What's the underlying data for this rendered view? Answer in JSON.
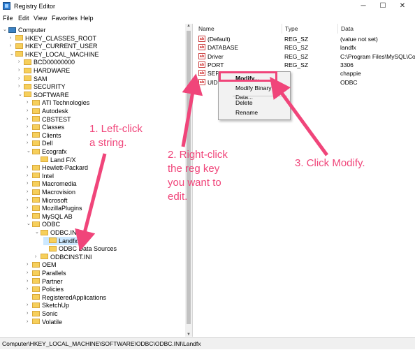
{
  "window": {
    "title": "Registry Editor",
    "minimize": "─",
    "maximize": "☐",
    "close": "✕"
  },
  "menu": [
    "File",
    "Edit",
    "View",
    "Favorites",
    "Help"
  ],
  "tree": [
    {
      "label": "Computer",
      "chev": "⌄",
      "icon": "computer"
    },
    {
      "label": "HKEY_CLASSES_ROOT",
      "chev": "›",
      "icon": "folder"
    },
    {
      "label": "HKEY_CURRENT_USER",
      "chev": "›",
      "icon": "folder"
    },
    {
      "label": "HKEY_LOCAL_MACHINE",
      "chev": "⌄",
      "icon": "folder"
    },
    {
      "label": "BCD00000000",
      "chev": "›",
      "icon": "folder"
    },
    {
      "label": "HARDWARE",
      "chev": "›",
      "icon": "folder"
    },
    {
      "label": "SAM",
      "chev": "›",
      "icon": "folder"
    },
    {
      "label": "SECURITY",
      "chev": "›",
      "icon": "folder"
    },
    {
      "label": "SOFTWARE",
      "chev": "⌄",
      "icon": "folder"
    },
    {
      "label": "ATI Technologies",
      "chev": "›",
      "icon": "folder"
    },
    {
      "label": "Autodesk",
      "chev": "›",
      "icon": "folder"
    },
    {
      "label": "CBSTEST",
      "chev": "›",
      "icon": "folder"
    },
    {
      "label": "Classes",
      "chev": "›",
      "icon": "folder"
    },
    {
      "label": "Clients",
      "chev": "›",
      "icon": "folder"
    },
    {
      "label": "Dell",
      "chev": "›",
      "icon": "folder"
    },
    {
      "label": "Ecografx",
      "chev": "⌄",
      "icon": "folder"
    },
    {
      "label": "Land F/X",
      "chev": "",
      "icon": "folder"
    },
    {
      "label": "Hewlett-Packard",
      "chev": "›",
      "icon": "folder"
    },
    {
      "label": "Intel",
      "chev": "›",
      "icon": "folder"
    },
    {
      "label": "Macromedia",
      "chev": "›",
      "icon": "folder"
    },
    {
      "label": "Macrovision",
      "chev": "›",
      "icon": "folder"
    },
    {
      "label": "Microsoft",
      "chev": "›",
      "icon": "folder"
    },
    {
      "label": "MozillaPlugins",
      "chev": "›",
      "icon": "folder"
    },
    {
      "label": "MySQL AB",
      "chev": "›",
      "icon": "folder"
    },
    {
      "label": "ODBC",
      "chev": "⌄",
      "icon": "folder"
    },
    {
      "label": "ODBC.INI",
      "chev": "⌄",
      "icon": "folder"
    },
    {
      "label": "Landfx",
      "chev": "",
      "icon": "folder"
    },
    {
      "label": "ODBC Data Sources",
      "chev": "",
      "icon": "folder"
    },
    {
      "label": "ODBCINST.INI",
      "chev": "›",
      "icon": "folder"
    },
    {
      "label": "OEM",
      "chev": "›",
      "icon": "folder"
    },
    {
      "label": "Parallels",
      "chev": "›",
      "icon": "folder"
    },
    {
      "label": "Partner",
      "chev": "›",
      "icon": "folder"
    },
    {
      "label": "Policies",
      "chev": "›",
      "icon": "folder"
    },
    {
      "label": "RegisteredApplications",
      "chev": "",
      "icon": "folder"
    },
    {
      "label": "SketchUp",
      "chev": "›",
      "icon": "folder"
    },
    {
      "label": "Sonic",
      "chev": "›",
      "icon": "folder"
    },
    {
      "label": "Volatile",
      "chev": "›",
      "icon": "folder"
    }
  ],
  "columns": {
    "name": "Name",
    "type": "Type",
    "data": "Data"
  },
  "values": [
    {
      "name": "(Default)",
      "type": "REG_SZ",
      "data": "(value not set)"
    },
    {
      "name": "DATABASE",
      "type": "REG_SZ",
      "data": "landfx"
    },
    {
      "name": "Driver",
      "type": "REG_SZ",
      "data": "C:\\Program Files\\MySQL\\Co"
    },
    {
      "name": "PORT",
      "type": "REG_SZ",
      "data": "3306"
    },
    {
      "name": "SERV",
      "type": "",
      "data": "chappie"
    },
    {
      "name": "UID",
      "type": "",
      "data": "ODBC"
    }
  ],
  "context_menu": {
    "modify": "Modify...",
    "modify_binary": "Modify Binary Data...",
    "delete": "Delete",
    "rename": "Rename"
  },
  "statusbar": "Computer\\HKEY_LOCAL_MACHINE\\SOFTWARE\\ODBC\\ODBC.INI\\Landfx",
  "annotations": {
    "step1_line1": "1. Left-click",
    "step1_line2": "a string.",
    "step2_line1": "2. Right-click",
    "step2_line2": "the reg key",
    "step2_line3": "you want to",
    "step2_line4": "edit.",
    "step3": "3. Click Modify."
  },
  "colors": {
    "annotation": "#f0457a",
    "selection": "#cce8ff",
    "folder": "#f6cf5b"
  }
}
